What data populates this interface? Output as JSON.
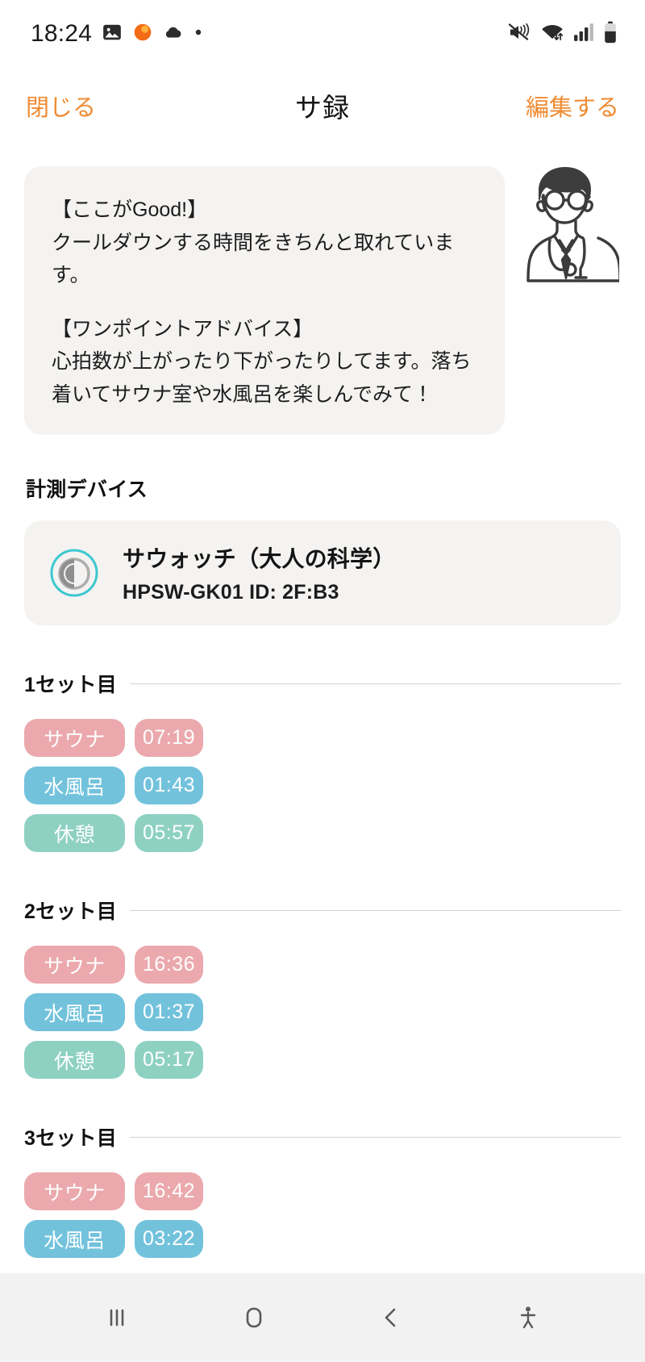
{
  "status_bar": {
    "time": "18:24",
    "left_icons": [
      "photo-icon",
      "orange-dot-icon",
      "cloud-icon",
      "small-dot-icon"
    ],
    "right_icons": [
      "mute-icon",
      "wifi-icon",
      "signal-icon",
      "battery-icon"
    ]
  },
  "header": {
    "close_label": "閉じる",
    "title": "サ録",
    "edit_label": "編集する"
  },
  "advice": {
    "good_heading": "【ここがGood!】",
    "good_body": "クールダウンする時間をきちんと取れています。",
    "tip_heading": "【ワンポイントアドバイス】",
    "tip_body": "心拍数が上がったり下がったりしてます。落ち着いてサウナ室や水風呂を楽しんでみて！",
    "avatar": "doctor-illustration"
  },
  "device_section": {
    "label": "計測デバイス",
    "device": {
      "icon": "watch-ring-icon",
      "name": "サウォッチ（大人の科学）",
      "meta": "HPSW-GK01  ID: 2F:B3"
    }
  },
  "colors": {
    "accent": "#ef8b33",
    "sauna": "#eba9ad",
    "cold_bath": "#72c2dc",
    "rest": "#8ed1c3",
    "card_bg": "#f4f3f1",
    "nav_bg": "#f2f2f2"
  },
  "sets": [
    {
      "title": "1セット目",
      "rows": [
        {
          "label": "サウナ",
          "time": "07:19",
          "kind": "sauna"
        },
        {
          "label": "水風呂",
          "time": "01:43",
          "kind": "cold_bath"
        },
        {
          "label": "休憩",
          "time": "05:57",
          "kind": "rest"
        }
      ]
    },
    {
      "title": "2セット目",
      "rows": [
        {
          "label": "サウナ",
          "time": "16:36",
          "kind": "sauna"
        },
        {
          "label": "水風呂",
          "time": "01:37",
          "kind": "cold_bath"
        },
        {
          "label": "休憩",
          "time": "05:17",
          "kind": "rest"
        }
      ]
    },
    {
      "title": "3セット目",
      "rows": [
        {
          "label": "サウナ",
          "time": "16:42",
          "kind": "sauna"
        },
        {
          "label": "水風呂",
          "time": "03:22",
          "kind": "cold_bath"
        }
      ]
    }
  ],
  "nav_bar": {
    "recents_label": "recents-icon",
    "home_label": "home-icon",
    "back_label": "back-icon",
    "accessibility_label": "accessibility-icon"
  }
}
